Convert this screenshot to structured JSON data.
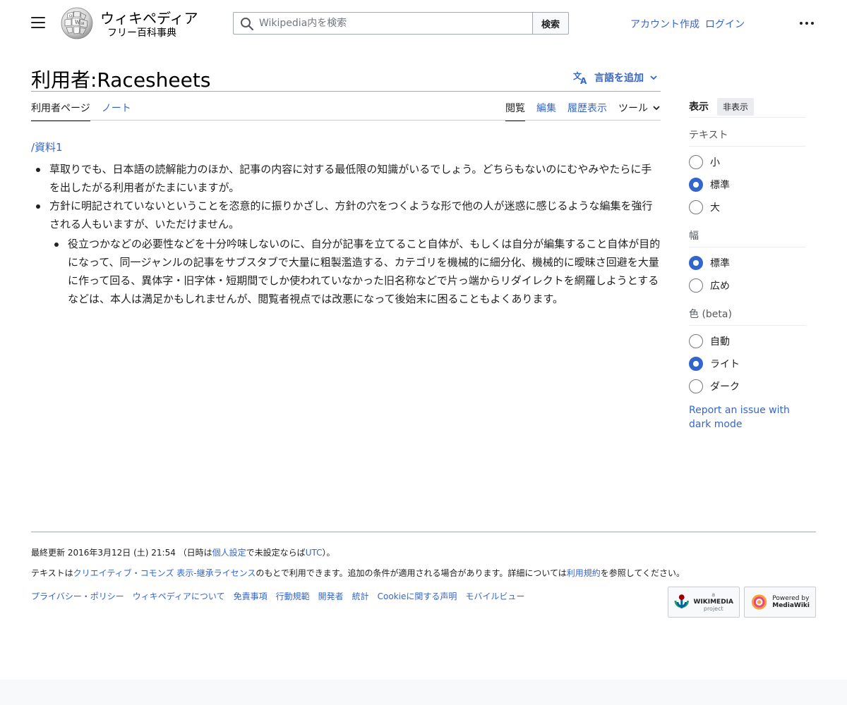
{
  "header": {
    "wordmark": "ウィキペディア",
    "tagline": "フリー百科事典",
    "search_placeholder": "Wikipedia内を検索",
    "search_button": "検索",
    "create_account": "アカウント作成",
    "login": "ログイン"
  },
  "page": {
    "title": "利用者:Racesheets",
    "add_languages": "言語を追加"
  },
  "tabs": {
    "user_page": "利用者ページ",
    "talk": "ノート",
    "read": "閲覧",
    "edit": "編集",
    "history": "履歴表示",
    "tools": "ツール"
  },
  "content": {
    "sub_link": "/資料1",
    "bullets": [
      "草取りでも、日本語の読解能力のほか、記事の内容に対する最低限の知識がいるでしょう。どちらもないのにむやみやたらに手を出したがる利用者がたまにいますが。",
      "方針に明記されていないということを恣意的に振りかざし、方針の穴をつくような形で他の人が迷惑に感じるような編集を強行される人もいますが、いただけません。"
    ],
    "sub_bullets": [
      "役立つかなどの必要性などを十分吟味しないのに、自分が記事を立てること自体が、もしくは自分が編集すること自体が目的になって、同一ジャンルの記事をサブスタブで大量に粗製濫造する、カテゴリを機械的に細分化、機械的に曖昧さ回避を大量に作って回る、異体字・旧字体・短期間でしか使われていなかった旧名称などで片っ端からリダイレクトを網羅しようとするなどは、本人は満足かもしれませんが、閲覧者視点では改悪になって後始末に困ることもよくあります。"
    ]
  },
  "appearance": {
    "heading": "表示",
    "hide": "非表示",
    "text_label": "テキスト",
    "text_options": [
      "小",
      "標準",
      "大"
    ],
    "text_selected": 1,
    "width_label": "幅",
    "width_options": [
      "標準",
      "広め"
    ],
    "width_selected": 0,
    "color_label": "色 (beta)",
    "color_options": [
      "自動",
      "ライト",
      "ダーク"
    ],
    "color_selected": 1,
    "report_link": "Report an issue with dark mode"
  },
  "footer": {
    "last_edit_prefix": "最終更新 2016年3月12日 (土) 21:54 （日時は",
    "personal_settings": "個人設定",
    "last_edit_middle": "で未設定ならば",
    "utc": "UTC",
    "last_edit_suffix": "）。",
    "license_prefix": "テキストは",
    "license_link": "クリエイティブ・コモンズ 表示-継承ライセンス",
    "license_middle": "のもとで利用できます。追加の条件が適用される場合があります。詳細については",
    "terms_link": "利用規約",
    "license_suffix": "を参照してください。",
    "links": [
      "プライバシー・ポリシー",
      "ウィキペディアについて",
      "免責事項",
      "行動規範",
      "開発者",
      "統計",
      "Cookieに関する声明",
      "モバイルビュー"
    ],
    "wikimedia_badge": [
      "a",
      "WIKIMEDIA",
      "project"
    ],
    "mediawiki_badge": [
      "Powered by",
      "MediaWiki"
    ]
  }
}
